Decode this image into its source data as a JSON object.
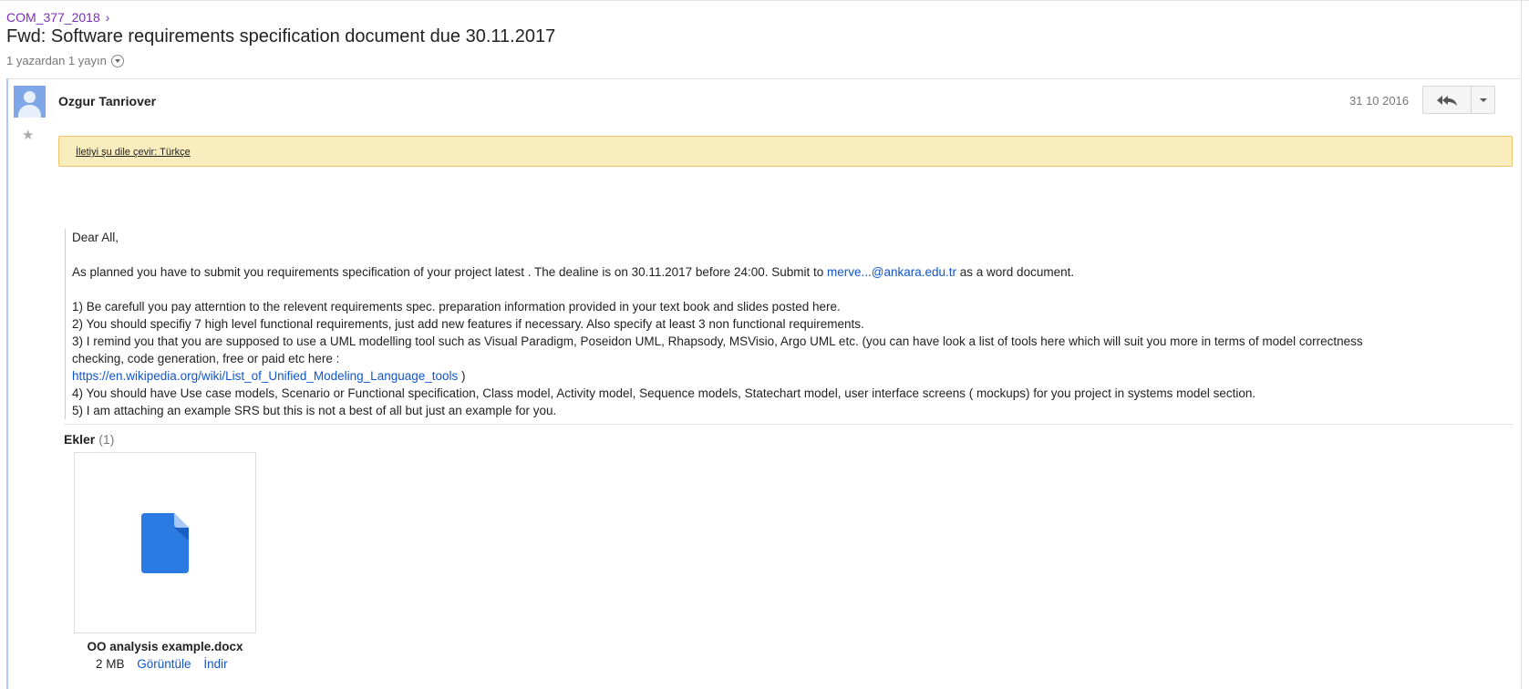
{
  "breadcrumb": {
    "group": "COM_377_2018",
    "chevron": "›"
  },
  "thread": {
    "subject": "Fwd: Software requirements specification document due 30.11.2017",
    "meta": "1 yazardan 1 yayın"
  },
  "message": {
    "sender": "Ozgur Tanriover",
    "date": "31 10 2016",
    "translate_link": "İletiyi şu dile çevir: Türkçe",
    "body": {
      "greeting": "Dear All,",
      "para_pre": "As planned you have to submit you requirements specification of your project latest . The dealine is on 30.11.2017 before 24:00. Submit to ",
      "email_link": "merve...@ankara.edu.tr",
      "para_post": " as a word document.",
      "item1": "1) Be carefull you pay atterntion to the relevent requirements spec. preparation information provided in your text book and slides posted here.",
      "item2": "2) You should specifiy  7 high level functional requirements, just add new features if necessary. Also specify at least 3 non functional requirements.",
      "item3a": "3) I remind you that you are supposed to use a UML modelling tool such as Visual Paradigm, Poseidon UML, Rhapsody, MSVisio, Argo UML etc. (you can have look a list of tools here which will suit you more in terms of model correctness",
      "item3b": "checking, code generation, free or paid etc here :",
      "url": "https://en.wikipedia.org/wiki/List_of_Unified_Modeling_Language_tools",
      "url_after": " )",
      "item4": "4) You should have Use case models, Scenario or Functional specification, Class model, Activity model, Sequence models, Statechart model, user interface screens ( mockups) for you project in systems model section.",
      "item5": "5) I am attaching an example SRS but this is not a best of all but just an example for you."
    }
  },
  "attachments": {
    "heading": "Ekler",
    "count": "(1)",
    "items": [
      {
        "name": "OO analysis example.docx",
        "size": "2 MB",
        "view_label": "Görüntüle",
        "download_label": "İndir"
      }
    ]
  },
  "colors": {
    "link": "#1155cc",
    "breadcrumb": "#7a2fb3",
    "translate_bg": "#faedbd",
    "doc_icon": "#2a7ae2"
  },
  "icons": [
    "star-icon",
    "avatar-icon",
    "reply-all-icon",
    "dropdown-arrow-icon",
    "document-icon"
  ]
}
